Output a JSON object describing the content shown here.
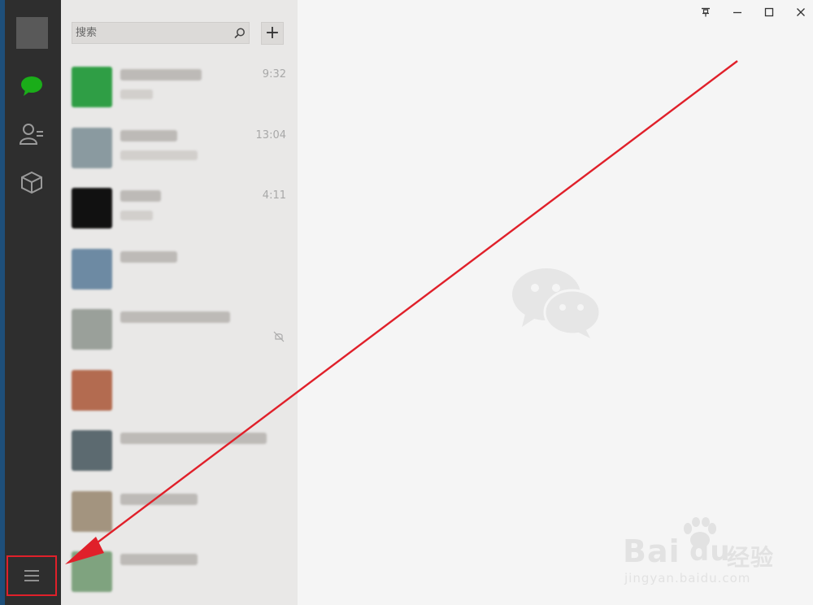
{
  "search": {
    "placeholder": "搜索"
  },
  "toolbar": {
    "add_label": "+"
  },
  "chats": [
    {
      "time": "9:32",
      "avatar_color": "#2f9e45"
    },
    {
      "time": "13:04",
      "avatar_color": "#8a9aa0"
    },
    {
      "time": "4:11",
      "avatar_color": "#111111"
    },
    {
      "time": "",
      "avatar_color": "#6d8aa3"
    },
    {
      "time": "",
      "avatar_color": "#9aa09a",
      "muted": true
    },
    {
      "time": "",
      "avatar_color": "#b36b50"
    },
    {
      "time": "",
      "avatar_color": "#5c6a70"
    },
    {
      "time": "",
      "avatar_color": "#a3947f"
    },
    {
      "time": "",
      "avatar_color": "#7fa37f"
    }
  ],
  "window_controls": {
    "pin": "⚲",
    "minimize": "–",
    "maximize": "☐",
    "close": "✕"
  },
  "watermark": {
    "brand": "Bai",
    "brand2": "du",
    "suffix": "经验",
    "url": "jingyan.baidu.com"
  },
  "colors": {
    "accent_green": "#1aad19",
    "annotation_red": "#e0202a",
    "rail": "#2e2e2e"
  }
}
